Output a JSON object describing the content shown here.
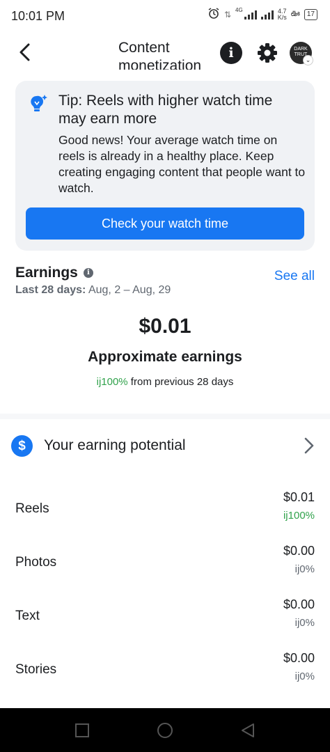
{
  "status_bar": {
    "time": "10:01 PM",
    "network": "4G",
    "speed_value": "4.7",
    "speed_unit": "K/s",
    "battery": "17"
  },
  "header": {
    "title": "Content monetization",
    "avatar_text": "DARK TRUT"
  },
  "tip": {
    "title": "Tip: Reels with higher watch time may earn more",
    "body": "Good news! Your average watch time on reels is already in a healthy place. Keep creating engaging content that people want to watch.",
    "button_label": "Check your watch time"
  },
  "earnings": {
    "title": "Earnings",
    "see_all": "See all",
    "period_label": "Last 28 days:",
    "period_range": " Aug, 2 – Aug, 29",
    "amount": "$0.01",
    "amount_label": "Approximate earnings",
    "change_value": "ij100%",
    "change_text": " from previous 28 days"
  },
  "potential": {
    "label": "Your earning potential"
  },
  "breakdown": [
    {
      "label": "Reels",
      "value": "$0.01",
      "change": "ij100%"
    },
    {
      "label": "Photos",
      "value": "$0.00",
      "change": "ij0%"
    },
    {
      "label": "Text",
      "value": "$0.00",
      "change": "ij0%"
    },
    {
      "label": "Stories",
      "value": "$0.00",
      "change": "ij0%"
    }
  ],
  "colors": {
    "accent": "#1877f2",
    "positive": "#31a24c",
    "card_bg": "#f0f2f5"
  }
}
